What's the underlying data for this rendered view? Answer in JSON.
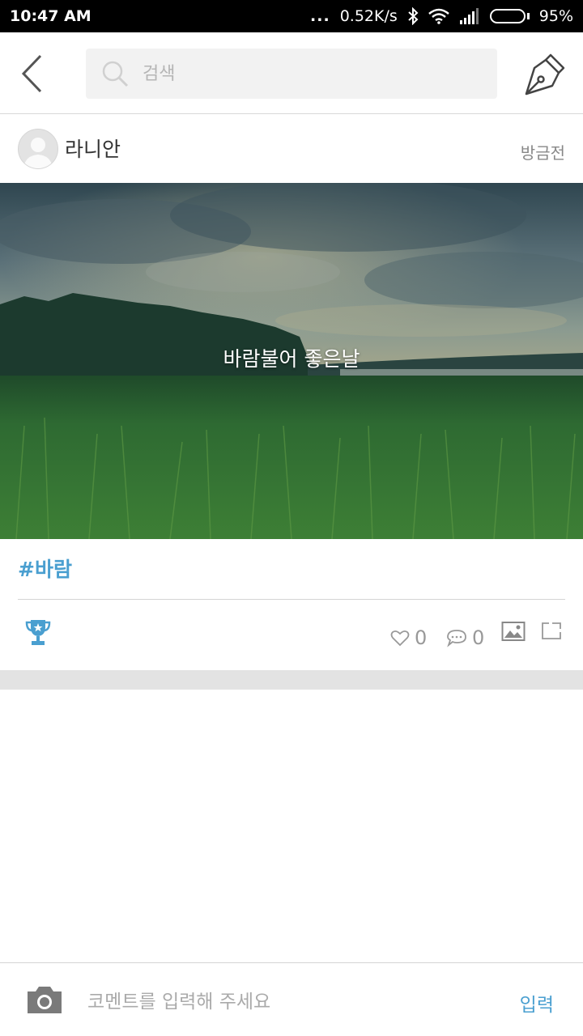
{
  "status_bar": {
    "time": "10:47 AM",
    "dots": "...",
    "network_speed": "0.52K/s",
    "battery_percent": "95%",
    "battery_level": 0.95,
    "icons": [
      "bluetooth-icon",
      "wifi-icon",
      "signal-icon",
      "battery-icon"
    ]
  },
  "header": {
    "search_placeholder": "검색",
    "icons": [
      "back-arrow-icon",
      "search-icon",
      "pen-icon"
    ]
  },
  "post": {
    "author": "라니안",
    "time": "방금전",
    "image_caption": "바람불어 좋은날",
    "hashtag": "#바람",
    "likes": "0",
    "comments": "0",
    "icons": [
      "avatar-icon",
      "trophy-icon",
      "heart-icon",
      "comment-icon",
      "image-icon",
      "share-icon"
    ]
  },
  "comment_bar": {
    "placeholder": "코멘트를 입력해 주세요",
    "submit_label": "입력",
    "icons": [
      "camera-icon"
    ]
  },
  "colors": {
    "accent": "#4a9fd0",
    "status_bar": "#000000",
    "search_bg": "#f2f2f2",
    "separator": "#e3e3e3"
  }
}
